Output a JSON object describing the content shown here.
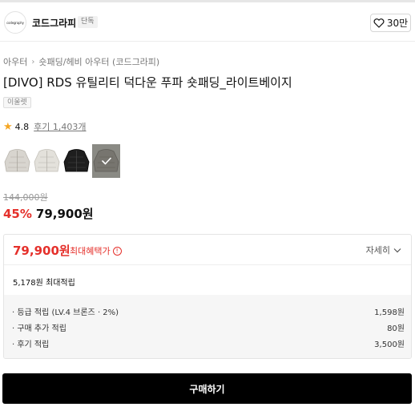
{
  "brand": {
    "logo_text": "codegraphy",
    "name": "코드그라피",
    "badge": "단독",
    "like_count": "30만"
  },
  "breadcrumb": {
    "level1": "아우터",
    "level2": "숏패딩/헤비 아우터 (코드그라피)"
  },
  "product": {
    "title": "[DIVO] RDS 유틸리티 덕다운 푸파 숏패딩_라이트베이지",
    "tag": "이울렛",
    "rating": "4.8",
    "reviews": "후기 1,403개",
    "thumbnails": [
      {
        "name": "light-grey-puffer",
        "color": "#d8d5cf"
      },
      {
        "name": "light-beige-puffer",
        "color": "#e3e1db"
      },
      {
        "name": "black-puffer",
        "color": "#1e1e1e"
      },
      {
        "name": "grey-puffer",
        "color": "#77756f"
      }
    ],
    "original_price": "144,000원",
    "discount": "45%",
    "final_price": "79,900원"
  },
  "benefit": {
    "price": "79,900원",
    "max_label": "최대혜택가",
    "info_symbol": "!",
    "detail_label": "자세히",
    "points_total": "5,178원 최대적립",
    "points": [
      {
        "label": "· 등급 적립 (LV.4 브론즈 · 2%)",
        "value": "1,598원"
      },
      {
        "label": "· 구매 추가 적립",
        "value": "80원"
      },
      {
        "label": "· 후기 적립",
        "value": "3,500원"
      }
    ]
  },
  "buy_button": "구매하기",
  "colors": {
    "accent_red": "#e5302b",
    "star": "#f5a623",
    "buy_button_bg": "#000000"
  }
}
